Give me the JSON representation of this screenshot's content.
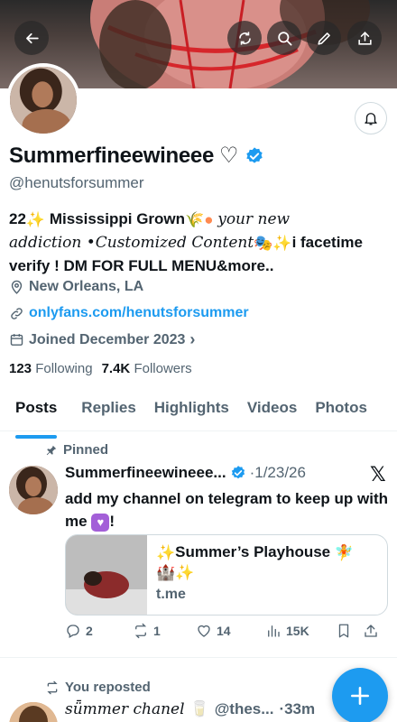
{
  "header": {
    "back_icon": "arrow-left-icon",
    "actions": [
      "refresh-icon",
      "search-icon",
      "edit-icon",
      "share-icon"
    ]
  },
  "profile": {
    "display_name": "Summerfineewineee",
    "heart": "♡",
    "verified": true,
    "handle": "@henutsforsummer",
    "bio": {
      "line1_a": "22",
      "line1_b": "Mississippi Grown",
      "line1_c": "your new",
      "line2_a": "addiction •Customized Content",
      "line2_b": "i facetime",
      "line3": "verify ! DM FOR FULL MENU&more.."
    },
    "location": "New Orleans, LA",
    "link": "onlyfans.com/henutsforsummer",
    "joined": "Joined December 2023",
    "following_count": "123",
    "following_label": "Following",
    "followers_count": "7.4K",
    "followers_label": "Followers"
  },
  "tabs": [
    "Posts",
    "Replies",
    "Highlights",
    "Videos",
    "Photos"
  ],
  "active_tab": "Posts",
  "pinned_post": {
    "pinned_label": "Pinned",
    "author": "Summerfineewineee...",
    "date": "·1/23/26",
    "text_a": "add my channel on telegram to keep up",
    "text_b": "with me",
    "text_c": "!",
    "card": {
      "title": "Summer’s Playhouse",
      "domain": "t.me"
    },
    "stats": {
      "replies": "2",
      "reposts": "1",
      "likes": "14",
      "views": "15K"
    }
  },
  "second_post": {
    "repost_label": "You reposted",
    "author": "sǖmmer chanel",
    "handle": "@thes...",
    "time": "·33m"
  },
  "colors": {
    "accent": "#1d9bf0",
    "text_primary": "#0f1419",
    "text_secondary": "#536471"
  }
}
